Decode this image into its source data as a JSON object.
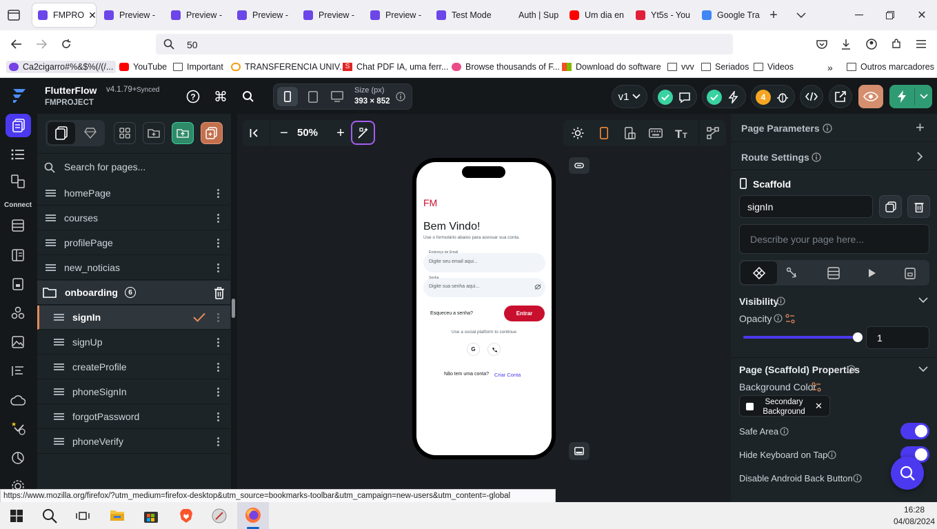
{
  "browser": {
    "tabs": [
      {
        "label": "FMPRO",
        "active": true,
        "favicon": "flutterflow-icon"
      },
      {
        "label": "Preview -",
        "favicon": "flutterflow-icon"
      },
      {
        "label": "Preview -",
        "favicon": "flutterflow-icon"
      },
      {
        "label": "Preview -",
        "favicon": "flutterflow-icon"
      },
      {
        "label": "Preview -",
        "favicon": "flutterflow-icon"
      },
      {
        "label": "Preview -",
        "favicon": "flutterflow-icon"
      },
      {
        "label": "Test Mode",
        "favicon": "flutterflow-icon"
      },
      {
        "label": "Auth | Sup",
        "favicon": "supabase-icon"
      },
      {
        "label": "Um dia en",
        "favicon": "youtube-icon"
      },
      {
        "label": "Yt5s - You",
        "favicon": "yt5s-icon"
      },
      {
        "label": "Google Tra",
        "favicon": "google-translate-icon"
      }
    ],
    "address": "50",
    "bookmarks": [
      {
        "label": "Ca2cigarro#%&$%(/(/...",
        "icon": "globe-icon"
      },
      {
        "label": "YouTube",
        "icon": "youtube-icon"
      },
      {
        "label": "Important",
        "icon": "folder-icon"
      },
      {
        "label": "TRANSFERENCIA UNIV...",
        "icon": "link-icon"
      },
      {
        "label": "Chat PDF IA, uma ferr...",
        "icon": "s-icon"
      },
      {
        "label": "Browse thousands of F...",
        "icon": "dribbble-icon"
      },
      {
        "label": "Download do software",
        "icon": "microsoft-icon"
      },
      {
        "label": "vvv",
        "icon": "folder-icon"
      },
      {
        "label": "Seriados",
        "icon": "folder-icon"
      },
      {
        "label": "Videos",
        "icon": "folder-icon"
      }
    ],
    "other_bookmarks": "Outros marcadores",
    "status_url": "https://www.mozilla.org/firefox/?utm_medium=firefox-desktop&utm_source=bookmarks-toolbar&utm_campaign=new-users&utm_content=-global"
  },
  "app": {
    "name": "FlutterFlow",
    "version": "v4.1.79+",
    "sync": "Synced",
    "project": "FMPROJECT",
    "size_label": "Size (px)",
    "size_value": "393 × 852",
    "version_select": "v1",
    "notification_count": "4",
    "leftnav_connect": "Connect",
    "zoom": "50%",
    "search_placeholder": "Search for pages...",
    "pages_top": [
      "homePage",
      "courses",
      "profilePage",
      "new_noticias"
    ],
    "folder": {
      "name": "onboarding",
      "count": "6"
    },
    "folder_pages": [
      "signIn",
      "signUp",
      "createProfile",
      "phoneSignIn",
      "forgotPassword",
      "phoneVerify"
    ],
    "selected_page": "signIn"
  },
  "right_panel": {
    "page_parameters": "Page Parameters",
    "route_settings": "Route Settings",
    "scaffold": "Scaffold",
    "page_name": "signIn",
    "describe_placeholder": "Describe your page here...",
    "visibility": "Visibility",
    "opacity_label": "Opacity",
    "opacity_value": "1",
    "opacity_fraction": 1.0,
    "props_title": "Page (Scaffold) Properties",
    "bg_color_label": "Background Color",
    "bg_color_value": "Secondary Background",
    "safe_area": "Safe Area",
    "hide_keyboard": "Hide Keyboard on Tap",
    "disable_back": "Disable Android Back Button"
  },
  "phone_preview": {
    "logo": "FM",
    "title": "Bem Vindo!",
    "subtitle": "Use o formulário abaixo para acessar sua conta.",
    "email_label": "Endereço de Email",
    "email_placeholder": "Digite seu email aqui...",
    "password_label": "Senha",
    "password_placeholder": "Digite sua senha aqui...",
    "forgot": "Esqueceu a senha?",
    "login_button": "Entrar",
    "social_text": "Use a social platform to continue",
    "no_account": "Não tem uma conta?",
    "create_account": "Criar Conta"
  },
  "taskbar": {
    "time": "16:28",
    "date": "04/08/2024"
  },
  "colors": {
    "accent": "#4b39ef",
    "brand_red": "#c8102e",
    "app_bg": "#14181b",
    "panel": "#1d2428",
    "success": "#39d2a0",
    "warning": "#f5a623"
  }
}
